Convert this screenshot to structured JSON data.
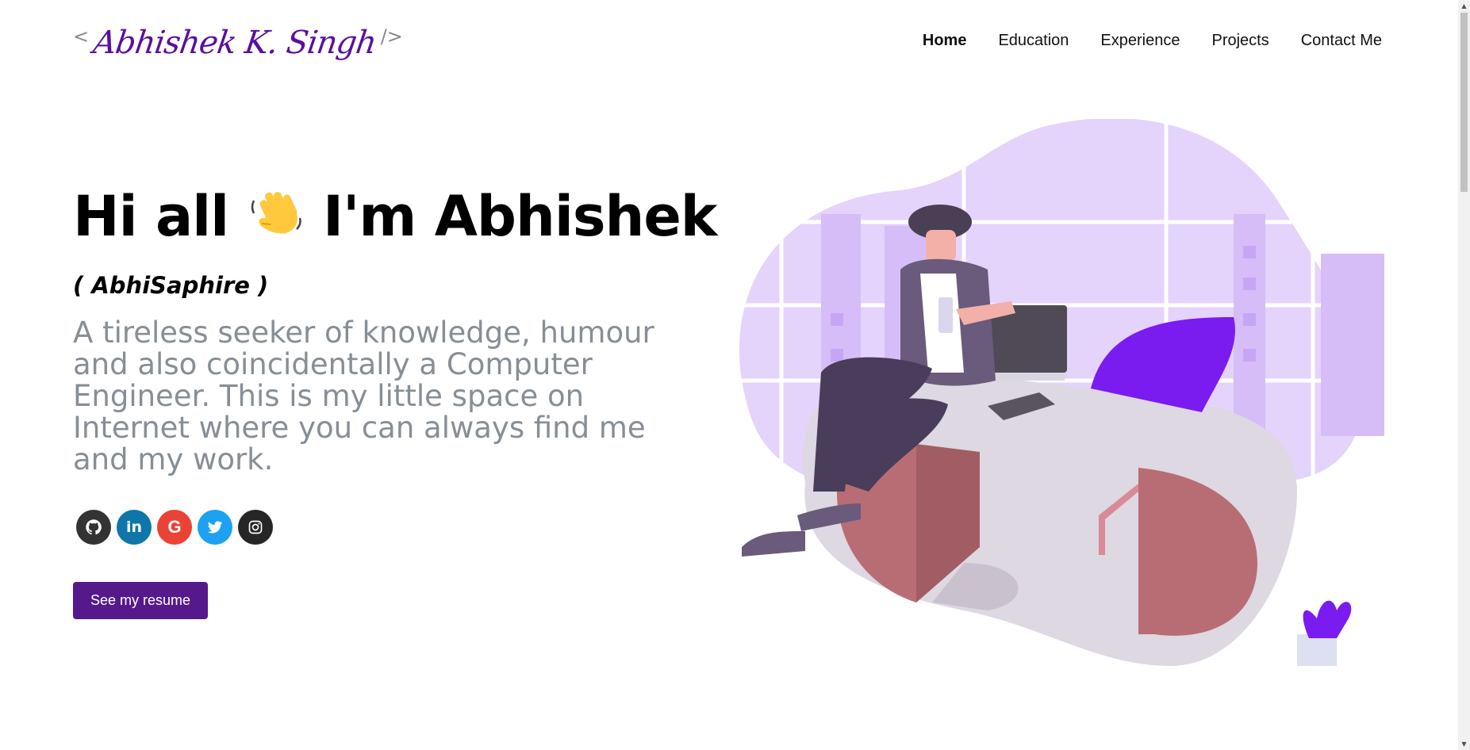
{
  "header": {
    "logo_open": "<",
    "logo_name": "Abhishek K. Singh",
    "logo_close": "/>",
    "nav": [
      {
        "label": "Home",
        "active": true
      },
      {
        "label": "Education",
        "active": false
      },
      {
        "label": "Experience",
        "active": false
      },
      {
        "label": "Projects",
        "active": false
      },
      {
        "label": "Contact Me",
        "active": false
      }
    ]
  },
  "hero": {
    "greeting_part1": "Hi all",
    "greeting_emoji": "👋",
    "greeting_part2": "I'm Abhishek",
    "nickname": "( AbhiSaphire )",
    "bio": "A tireless seeker of knowledge, humour and also coincidentally a Computer Engineer. This is my little space on Internet where you can always find me and my work.",
    "resume_button": "See my resume"
  },
  "social": [
    {
      "name": "github-icon",
      "color": "#333333"
    },
    {
      "name": "linkedin-icon",
      "color": "#0e76a8"
    },
    {
      "name": "google-icon",
      "color": "#ea4335"
    },
    {
      "name": "twitter-icon",
      "color": "#1da1f2"
    },
    {
      "name": "instagram-icon",
      "color": "#262626"
    }
  ],
  "colors": {
    "accent": "#55198b",
    "bio_text": "#868e96",
    "illustration_purple": "#7a1cf0",
    "desk_red": "#b86d74"
  },
  "social_glyphs": {
    "linkedin": "in",
    "google": "G"
  }
}
